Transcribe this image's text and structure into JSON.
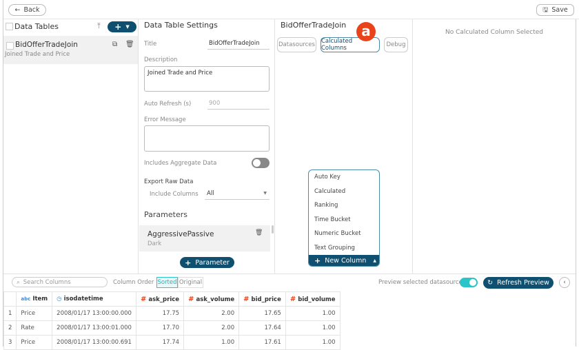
{
  "topbar": {
    "back_label": "Back",
    "save_label": "Save"
  },
  "data_tables": {
    "title": "Data Tables",
    "items": [
      {
        "name": "BidOfferTradeJoin",
        "description": "Joined Trade and Price"
      }
    ]
  },
  "settings": {
    "title": "Data Table Settings",
    "title_label": "Title",
    "title_value": "BidOfferTradeJoin",
    "description_label": "Description",
    "description_value": "Joined Trade and Price",
    "auto_refresh_label": "Auto Refresh (s)",
    "auto_refresh_placeholder": "900",
    "error_label": "Error Message",
    "aggregate_label": "Includes Aggregate Data",
    "aggregate_on": false,
    "export_label": "Export Raw Data",
    "include_columns_label": "Include Columns",
    "include_columns_value": "All",
    "parameters_title": "Parameters",
    "parameters": [
      {
        "name": "AggressivePassive",
        "value": "Dark"
      }
    ],
    "add_parameter_label": "Parameter"
  },
  "datasource_panel": {
    "title": "BidOfferTradeJoin",
    "tabs": [
      "Datasources",
      "Calculated Columns",
      "Debug"
    ],
    "active_tab": "Calculated Columns",
    "callout": "a",
    "menu_items": [
      "Auto Key",
      "Calculated",
      "Ranking",
      "Time Bucket",
      "Numeric Bucket",
      "Text Grouping"
    ],
    "new_column_label": "New Column"
  },
  "detail": {
    "empty_text": "No Calculated Column Selected"
  },
  "preview": {
    "search_placeholder": "Search Columns",
    "column_order_label": "Column Order",
    "order_options": [
      "Sorted",
      "Original"
    ],
    "order_selected": "Sorted",
    "preview_label": "Preview selected datasource",
    "preview_on": true,
    "refresh_label": "Refresh Preview"
  },
  "table": {
    "columns": [
      {
        "type": "abc",
        "name": "Item"
      },
      {
        "type": "time",
        "name": "isodatetime"
      },
      {
        "type": "#",
        "name": "ask_price"
      },
      {
        "type": "#",
        "name": "ask_volume"
      },
      {
        "type": "#",
        "name": "bid_price"
      },
      {
        "type": "#",
        "name": "bid_volume"
      }
    ],
    "rows": [
      [
        "1",
        "Price",
        "2008/01/17 13:00:00.000",
        "17.75",
        "2.00",
        "17.65",
        "1.00"
      ],
      [
        "2",
        "Rate",
        "2008/01/17 13:00:01.000",
        "17.70",
        "2.00",
        "17.64",
        "1.00"
      ],
      [
        "3",
        "Price",
        "2008/01/17 13:00:00.691",
        "17.74",
        "1.00",
        "17.61",
        "1.00"
      ]
    ]
  },
  "colors": {
    "primary": "#0f5070",
    "accent": "#2bc4c8",
    "callout": "#e8431b"
  }
}
